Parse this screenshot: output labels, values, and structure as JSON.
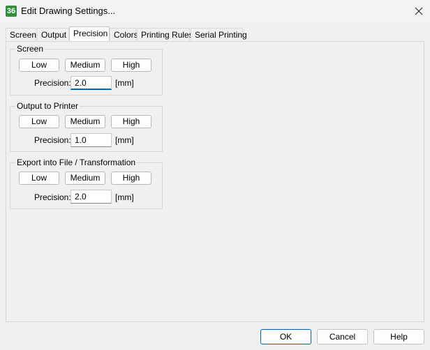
{
  "window": {
    "title": "Edit Drawing Settings...",
    "icon_text": "36"
  },
  "tabs": [
    {
      "label": "Screen"
    },
    {
      "label": "Output"
    },
    {
      "label": "Precision"
    },
    {
      "label": "Colors"
    },
    {
      "label": "Printing Rules"
    },
    {
      "label": "Serial Printing"
    }
  ],
  "active_tab": "Precision",
  "groups": [
    {
      "title": "Screen",
      "buttons": [
        "Low",
        "Medium",
        "High"
      ],
      "precision_label": "Precision:",
      "value": "2.0",
      "unit": "[mm]"
    },
    {
      "title": "Output to Printer",
      "buttons": [
        "Low",
        "Medium",
        "High"
      ],
      "precision_label": "Precision:",
      "value": "1.0",
      "unit": "[mm]"
    },
    {
      "title": "Export into File / Transformation",
      "buttons": [
        "Low",
        "Medium",
        "High"
      ],
      "precision_label": "Precision:",
      "value": "2.0",
      "unit": "[mm]"
    }
  ],
  "footer": {
    "ok": "OK",
    "cancel": "Cancel",
    "help": "Help"
  },
  "icons": {
    "close": "close-icon",
    "app": "app-icon"
  },
  "colors": {
    "accent": "#0067c0",
    "app_icon": "#2f8f3a"
  }
}
